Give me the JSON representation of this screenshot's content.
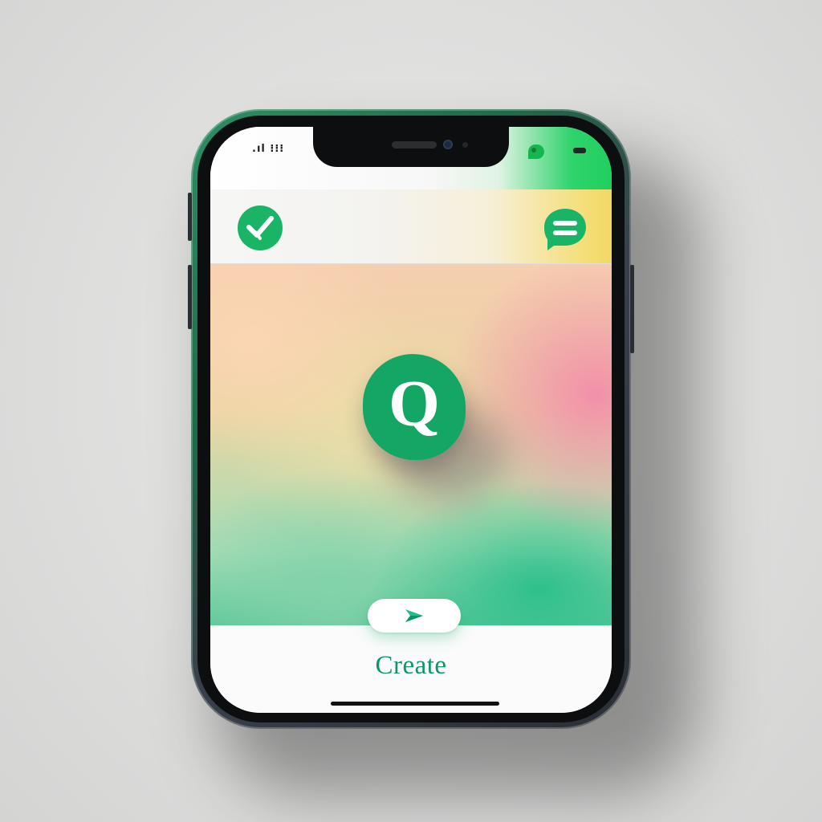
{
  "status_bar": {
    "time": ".ıl ⁝⁝⁝",
    "icon_left": "signal-icon",
    "icon_right": "chat-bubble-icon",
    "battery_icon": "battery-icon"
  },
  "header": {
    "left_button_icon": "check-icon",
    "right_button_icon": "chat-icon"
  },
  "main": {
    "logo_letter": "Q",
    "logo_icon": "app-logo-icon"
  },
  "bottom": {
    "play_icon": "play-arrow-icon",
    "create_label": "Create"
  },
  "colors": {
    "brand_green": "#14a665",
    "accent_green": "#19b466",
    "create_text": "#10946c",
    "header_yellow": "#f3d862",
    "status_green": "#20cf60"
  }
}
